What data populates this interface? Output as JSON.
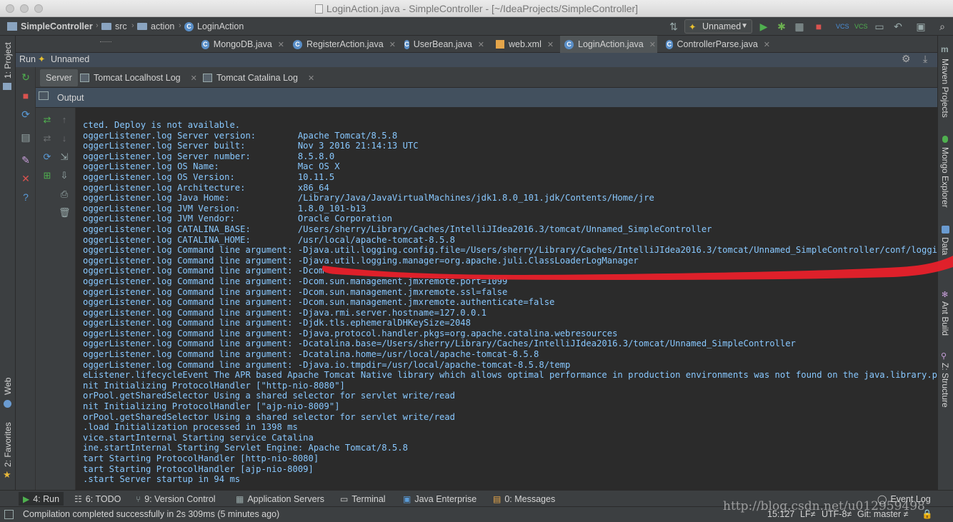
{
  "window": {
    "title": "LoginAction.java - SimpleController - [~/IdeaProjects/SimpleController]"
  },
  "navbar": {
    "crumbs": [
      "SimpleController",
      "src",
      "action",
      "LoginAction"
    ],
    "run_config": "Unnamed"
  },
  "editor_tabs": [
    {
      "label": "MongoDB.java",
      "active": false
    },
    {
      "label": "RegisterAction.java",
      "active": false
    },
    {
      "label": "UserBean.java",
      "active": false
    },
    {
      "label": "web.xml",
      "active": false
    },
    {
      "label": "LoginAction.java",
      "active": true
    },
    {
      "label": "ControllerParse.java",
      "active": false
    }
  ],
  "run_panel": {
    "header_prefix": "Run",
    "header_config": "Unnamed",
    "tabs": [
      {
        "label": "Server",
        "active": true
      },
      {
        "label": "Tomcat Localhost Log",
        "active": false
      },
      {
        "label": "Tomcat Catalina Log",
        "active": false
      }
    ],
    "output_label": "Output"
  },
  "left_strip": {
    "project": "1: Project",
    "web": "Web",
    "favorites": "2: Favorites"
  },
  "right_strip": {
    "maven": "Maven Projects",
    "mongo": "Mongo Explorer",
    "database": "Data",
    "ant": "Ant Build",
    "structure": "Z: Structure"
  },
  "console_lines": [
    "cted. Deploy is not available.",
    "oggerListener.log Server version:        Apache Tomcat/8.5.8",
    "oggerListener.log Server built:          Nov 3 2016 21:14:13 UTC",
    "oggerListener.log Server number:         8.5.8.0",
    "oggerListener.log OS Name:               Mac OS X",
    "oggerListener.log OS Version:            10.11.5",
    "oggerListener.log Architecture:          x86_64",
    "oggerListener.log Java Home:             /Library/Java/JavaVirtualMachines/jdk1.8.0_101.jdk/Contents/Home/jre",
    "oggerListener.log JVM Version:           1.8.0_101-b13",
    "oggerListener.log JVM Vendor:            Oracle Corporation",
    "oggerListener.log CATALINA_BASE:         /Users/sherry/Library/Caches/IntelliJIdea2016.3/tomcat/Unnamed_SimpleController",
    "oggerListener.log CATALINA_HOME:         /usr/local/apache-tomcat-8.5.8",
    "oggerListener.log Command line argument: -Djava.util.logging.config.file=/Users/sherry/Library/Caches/IntelliJIdea2016.3/tomcat/Unnamed_SimpleController/conf/loggin",
    "oggerListener.log Command line argument: -Djava.util.logging.manager=org.apache.juli.ClassLoaderLogManager",
    "oggerListener.log Command line argument: -Dcom",
    "oggerListener.log Command line argument: -Dcom.sun.management.jmxremote.port=1099",
    "oggerListener.log Command line argument: -Dcom.sun.management.jmxremote.ssl=false",
    "oggerListener.log Command line argument: -Dcom.sun.management.jmxremote.authenticate=false",
    "oggerListener.log Command line argument: -Djava.rmi.server.hostname=127.0.0.1",
    "oggerListener.log Command line argument: -Djdk.tls.ephemeralDHKeySize=2048",
    "oggerListener.log Command line argument: -Djava.protocol.handler.pkgs=org.apache.catalina.webresources",
    "oggerListener.log Command line argument: -Dcatalina.base=/Users/sherry/Library/Caches/IntelliJIdea2016.3/tomcat/Unnamed_SimpleController",
    "oggerListener.log Command line argument: -Dcatalina.home=/usr/local/apache-tomcat-8.5.8",
    "oggerListener.log Command line argument: -Djava.io.tmpdir=/usr/local/apache-tomcat-8.5.8/temp",
    "eListener.lifecycleEvent The APR based Apache Tomcat Native library which allows optimal performance in production environments was not found on the java.library.pa",
    "nit Initializing ProtocolHandler [\"http-nio-8080\"]",
    "orPool.getSharedSelector Using a shared selector for servlet write/read",
    "nit Initializing ProtocolHandler [\"ajp-nio-8009\"]",
    "orPool.getSharedSelector Using a shared selector for servlet write/read",
    ".load Initialization processed in 1398 ms",
    "vice.startInternal Starting service Catalina",
    "ine.startInternal Starting Servlet Engine: Apache Tomcat/8.5.8",
    "tart Starting ProtocolHandler [http-nio-8080]",
    "tart Starting ProtocolHandler [ajp-nio-8009]",
    ".start Server startup in 94 ms"
  ],
  "bottom_tabs": [
    {
      "label": "4: Run",
      "active": true
    },
    {
      "label": "6: TODO",
      "active": false
    },
    {
      "label": "9: Version Control",
      "active": false
    },
    {
      "label": "Application Servers",
      "active": false
    },
    {
      "label": "Terminal",
      "active": false
    },
    {
      "label": "Java Enterprise",
      "active": false
    },
    {
      "label": "0: Messages",
      "active": false
    }
  ],
  "event_log": "Event Log",
  "status": {
    "message": "Compilation completed successfully in 2s 309ms (5 minutes ago)",
    "position": "15:127",
    "line_sep": "LF≠",
    "encoding": "UTF-8≠",
    "git": "Git: master ≠"
  },
  "watermark": "http://blog.csdn.net/u012959498",
  "colors": {
    "console_text": "#88c8ff",
    "console_bg": "#2b2b2b",
    "annotation_stroke": "#e8202a"
  }
}
